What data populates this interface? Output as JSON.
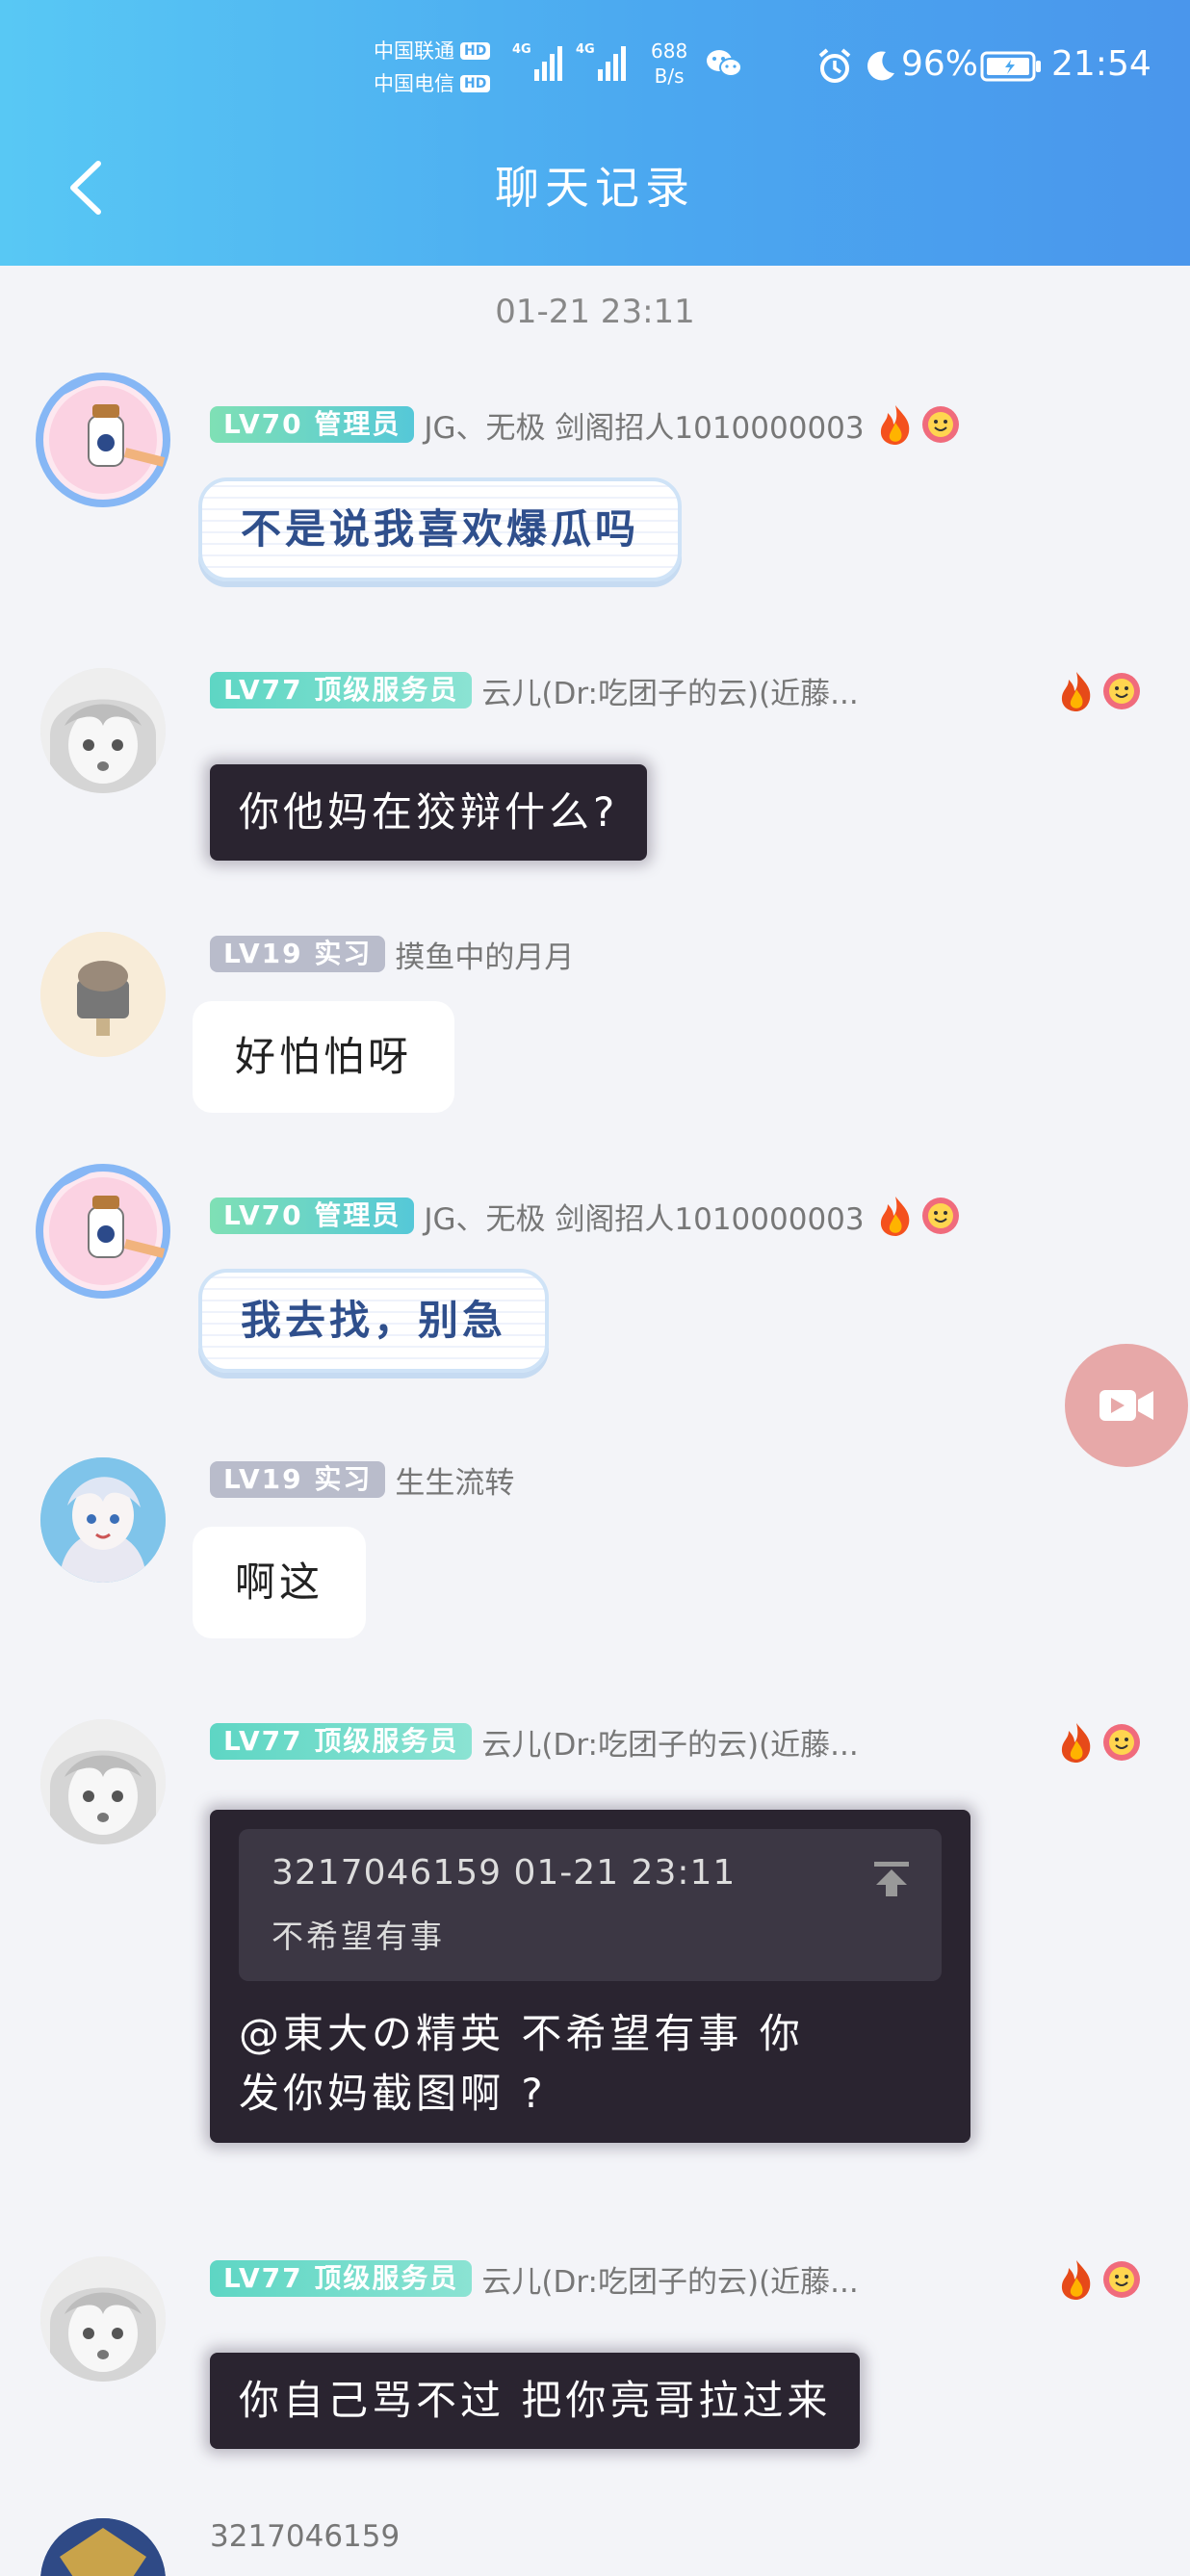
{
  "status_bar": {
    "carrier1": "中国联通",
    "carrier2": "中国电信",
    "hd": "HD",
    "net_tag1": "4G",
    "net_tag2": "4G",
    "net_speed_value": "688",
    "net_speed_unit": "B/s",
    "battery": "96%",
    "time": "21:54",
    "icons": [
      "wechat-icon",
      "alarm-icon",
      "moon-icon",
      "battery-icon"
    ]
  },
  "header": {
    "title": "聊天记录",
    "back_icon": "chevron-left-icon"
  },
  "chat": {
    "timestamp": "01-21 23:11",
    "messages": [
      {
        "badge": "LV70 管理员",
        "nick": "JG、无极 剑阁招人1010000003",
        "text": "不是说我喜欢爆瓜吗",
        "style": "cloud"
      },
      {
        "badge": "LV77 顶级服务员",
        "nick": "云儿(Dr:吃团子的云)(近藤...",
        "text": "你他妈在狡辩什么?",
        "style": "dark"
      },
      {
        "badge": "LV19 实习",
        "nick": "摸鱼中的月月",
        "text": "好怕怕呀",
        "style": "white"
      },
      {
        "badge": "LV70 管理员",
        "nick": "JG、无极 剑阁招人1010000003",
        "text": "我去找，别急",
        "style": "cloud"
      },
      {
        "badge": "LV19 实习",
        "nick": "生生流转",
        "text": "啊这",
        "style": "white"
      },
      {
        "badge": "LV77 顶级服务员",
        "nick": "云儿(Dr:吃团子的云)(近藤...",
        "quote_head": "3217046159 01-21 23:11",
        "quote_body": "不希望有事",
        "text_line1": "@東大の精英 不希望有事 你",
        "text_line2": "发你妈截图啊 ?",
        "style": "dark"
      },
      {
        "badge": "LV77 顶级服务员",
        "nick": "云儿(Dr:吃团子的云)(近藤...",
        "text": "你自己骂不过 把你亮哥拉过来",
        "style": "dark"
      },
      {
        "nick": "3217046159"
      }
    ]
  },
  "floating": {
    "video_icon": "video-camera-icon"
  },
  "colors": {
    "header_start": "#58c8f4",
    "header_end": "#4a96ec",
    "background": "#f3f4f8",
    "dark_bubble": "#2a2430",
    "fab": "#e7a8a8"
  }
}
